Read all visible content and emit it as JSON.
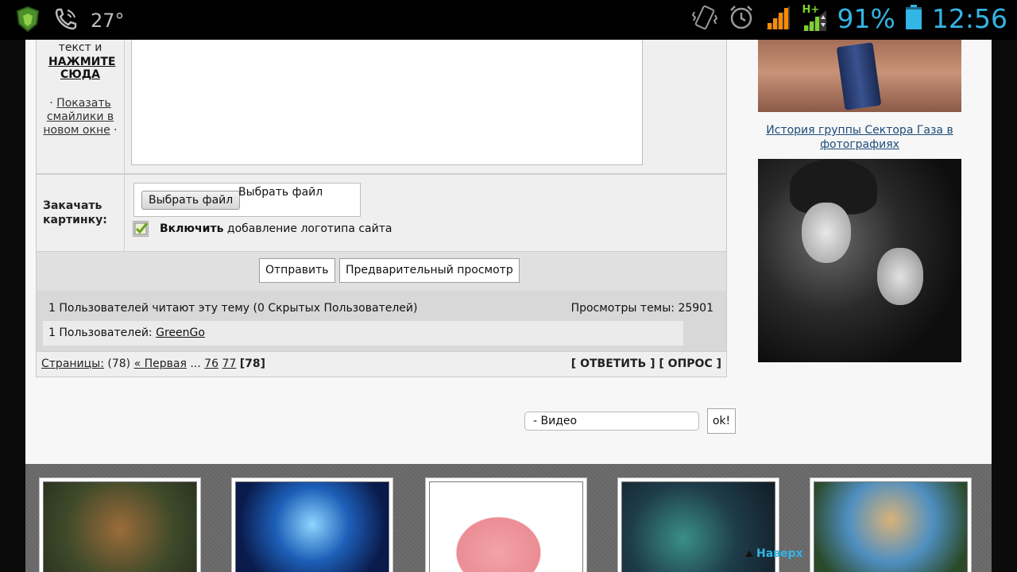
{
  "status_bar": {
    "temperature": "27°",
    "battery_percent": "91%",
    "time": "12:56",
    "network": "H+",
    "icons": [
      "shield-app-icon",
      "phone-icon",
      "vibrate-icon",
      "alarm-icon",
      "signal-icon",
      "mobile-data-icon",
      "battery-icon"
    ]
  },
  "form": {
    "smilies_label_top": "текст и",
    "click_here": "НАЖМИТЕ СЮДА",
    "show_smilies_dot_left": "·",
    "show_smilies_link": "Показать смайлики в новом окне",
    "show_smilies_dot_right": "·",
    "upload_label": "Закачать картинку:",
    "choose_file_button": "Выбрать файл",
    "file_status": "Выбрать файл",
    "logo_checkbox_bold": "Включить",
    "logo_checkbox_text": " добавление логотипа сайта",
    "logo_checked": true,
    "submit_button": "Отправить",
    "preview_button": "Предварительный просмотр"
  },
  "topic_info": {
    "readers": "1 Пользователей читают эту тему (0 Скрытых Пользователей)",
    "views": "Просмотры темы: 25901",
    "users_label": "1 Пользователей: ",
    "users_list": "GreenGo"
  },
  "pagination": {
    "pages_link": "Страницы:",
    "count": " (78) ",
    "first": "« Первая",
    "ellipsis": " ... ",
    "page_a": "76",
    "page_b": "77",
    "current": "[78]",
    "actions": "[ ОТВЕТИТЬ ] [ ОПРОС ]"
  },
  "jump": {
    "select_value": "- Видео",
    "ok_button": "ok!"
  },
  "sidebar": {
    "caption": "История группы Сектора Газа в фотографиях"
  },
  "footer": {
    "up_link": "Наверх"
  }
}
